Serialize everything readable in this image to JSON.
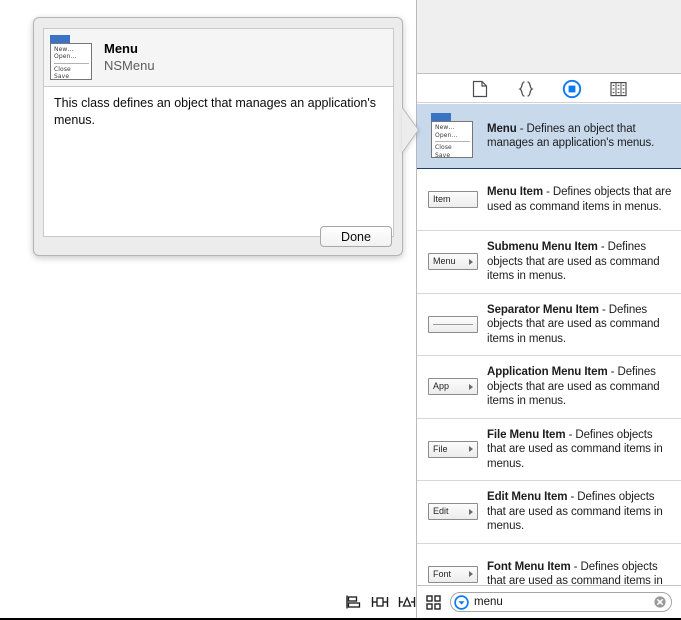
{
  "popover": {
    "title": "Menu",
    "subtitle": "NSMenu",
    "description": "This class defines an object that manages an application's menus.",
    "done_label": "Done",
    "icon": {
      "name": "menu-window-icon",
      "items": [
        "New…",
        "Open…",
        "Close",
        "Save"
      ]
    }
  },
  "library": {
    "tabs": [
      {
        "name": "file-template-icon",
        "label": "File Template Library",
        "selected": false
      },
      {
        "name": "code-snippet-icon",
        "label": "Code Snippet Library",
        "selected": false
      },
      {
        "name": "object-library-icon",
        "label": "Object Library",
        "selected": true
      },
      {
        "name": "media-library-icon",
        "label": "Media Library",
        "selected": false
      }
    ],
    "items": [
      {
        "title": "Menu",
        "description": " - Defines an object that manages an application's menus.",
        "selected": true,
        "glyph": {
          "type": "menu-window",
          "items": [
            "New…",
            "Open…",
            "Close",
            "Save"
          ]
        }
      },
      {
        "title": "Menu Item",
        "description": " - Defines objects that are used as command items in menus.",
        "selected": false,
        "glyph": {
          "type": "pill",
          "label": "Item",
          "arrow": false
        }
      },
      {
        "title": "Submenu Menu Item",
        "description": " - Defines objects that are used as command items in menus.",
        "selected": false,
        "glyph": {
          "type": "pill",
          "label": "Menu",
          "arrow": true
        }
      },
      {
        "title": "Separator Menu Item",
        "description": " - Defines objects that are used as command items in menus.",
        "selected": false,
        "glyph": {
          "type": "separator",
          "label": "",
          "arrow": false
        }
      },
      {
        "title": "Application Menu Item",
        "description": " - Defines objects that are used as command items in menus.",
        "selected": false,
        "glyph": {
          "type": "pill",
          "label": "App",
          "arrow": true
        }
      },
      {
        "title": "File Menu Item",
        "description": " - Defines objects that are used as command items in menus.",
        "selected": false,
        "glyph": {
          "type": "pill",
          "label": "File",
          "arrow": true
        }
      },
      {
        "title": "Edit Menu Item",
        "description": " - Defines objects that are used as command items in menus.",
        "selected": false,
        "glyph": {
          "type": "pill",
          "label": "Edit",
          "arrow": true
        }
      },
      {
        "title": "Font Menu Item",
        "description": " - Defines objects that are used as command items in",
        "selected": false,
        "glyph": {
          "type": "pill",
          "label": "Font",
          "arrow": true
        }
      }
    ]
  },
  "bottom_bar": {
    "tools": [
      {
        "name": "align-objects-icon",
        "label": "Align"
      },
      {
        "name": "pin-constraints-icon",
        "label": "Pin"
      },
      {
        "name": "resolve-issues-icon",
        "label": "Resolve Auto Layout Issues"
      }
    ],
    "grid_toggle": {
      "name": "grid-view-icon",
      "label": "Toggle Grid View"
    },
    "search": {
      "value": "menu",
      "placeholder": "",
      "scope_icon": "search-scope-icon",
      "clear_icon": "clear-search-icon"
    }
  },
  "colors": {
    "selection_blue": "#c9d9ec",
    "accent_blue": "#0a7bf0",
    "panel_gray": "#efefef",
    "popover_gray": "#ececec"
  }
}
